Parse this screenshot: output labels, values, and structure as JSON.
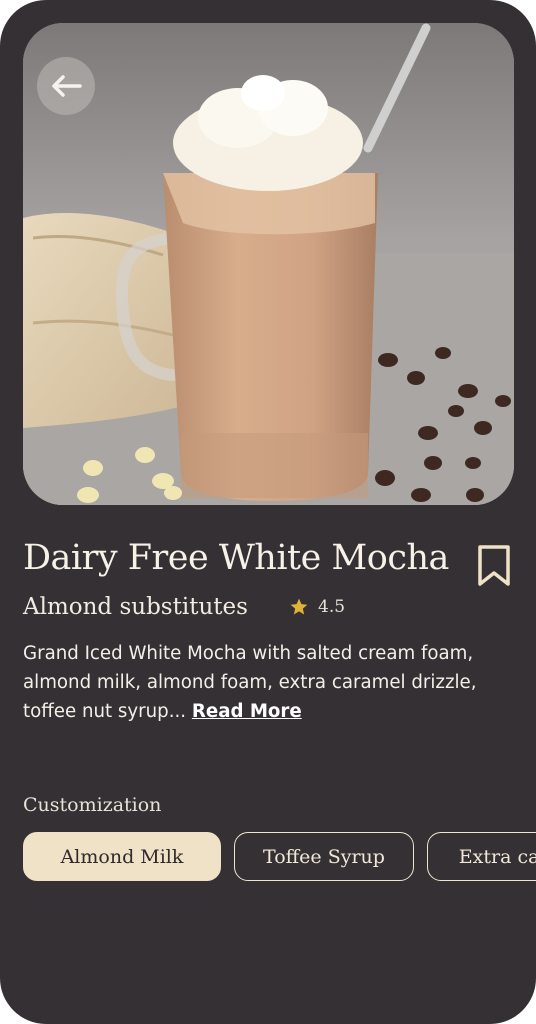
{
  "product": {
    "title": "Dairy Free White Mocha",
    "subtitle": "Almond substitutes",
    "rating": "4.5",
    "description": "Grand Iced White Mocha with salted cream foam, almond milk, almond foam, extra caramel drizzle, toffee nut syrup...",
    "read_more": "Read More"
  },
  "customization": {
    "label": "Customization",
    "options": [
      "Almond Milk",
      "Toffee Syrup",
      "Extra caramel"
    ],
    "selected": "Almond Milk"
  },
  "icons": {
    "back": "arrow-left-icon",
    "bookmark": "bookmark-icon",
    "rating": "star-icon"
  },
  "colors": {
    "background": "#353034",
    "accent": "#efe2c7",
    "star": "#e0b23a",
    "text": "#f7f1e8"
  }
}
